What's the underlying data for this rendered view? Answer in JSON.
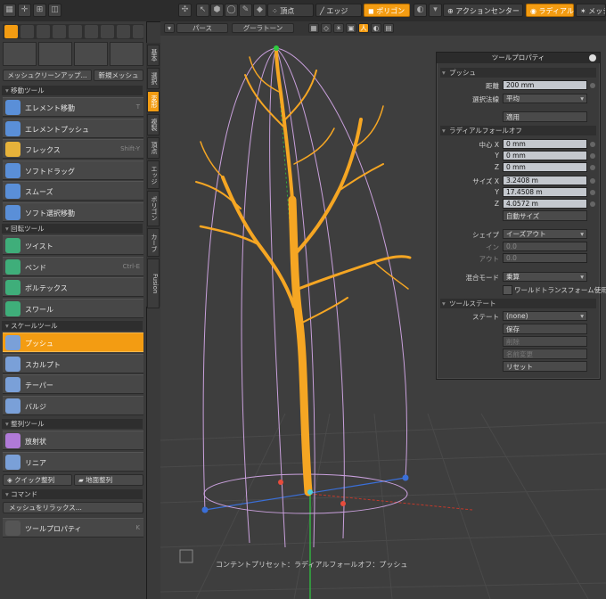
{
  "toolbar": {
    "vertex": "頂点",
    "edge": "エッジ",
    "polygon": "ポリゴン",
    "action_center": "アクションセンター",
    "radial": "ラディアル",
    "mesh": "メッシュ"
  },
  "viewport_header": {
    "perspective": "パース",
    "shading": "グーラトーン"
  },
  "left_panel": {
    "top_buttons": {
      "mesh_cleanup": "メッシュクリーンアップ...",
      "new_mesh": "新規メッシュ"
    },
    "sections": {
      "move": "移動ツール",
      "rotate": "回転ツール",
      "scale": "スケールツール",
      "align": "整列ツール",
      "command": "コマンド"
    },
    "move_tools": [
      {
        "label": "エレメント移動",
        "shortcut": "T"
      },
      {
        "label": "エレメントプッシュ",
        "shortcut": ""
      },
      {
        "label": "フレックス",
        "shortcut": "Shift-Y"
      },
      {
        "label": "ソフトドラッグ",
        "shortcut": ""
      },
      {
        "label": "スムーズ",
        "shortcut": ""
      },
      {
        "label": "ソフト選択移動",
        "shortcut": ""
      }
    ],
    "rotate_tools": [
      {
        "label": "ツイスト",
        "shortcut": ""
      },
      {
        "label": "ベンド",
        "shortcut": "Ctrl-E"
      },
      {
        "label": "ボルテックス",
        "shortcut": ""
      },
      {
        "label": "スワール",
        "shortcut": ""
      }
    ],
    "scale_tools": [
      {
        "label": "プッシュ",
        "shortcut": ""
      },
      {
        "label": "スカルプト",
        "shortcut": ""
      },
      {
        "label": "テーパー",
        "shortcut": ""
      },
      {
        "label": "バルジ",
        "shortcut": ""
      }
    ],
    "align_tools": [
      {
        "label": "放射状",
        "shortcut": ""
      },
      {
        "label": "リニア",
        "shortcut": ""
      }
    ],
    "quick_align": "クイック整列",
    "ground_align": "地面整列",
    "relax": "メッシュをリラックス...",
    "tool_properties": {
      "label": "ツールプロパティ",
      "shortcut": "K"
    }
  },
  "vertical_tabs": [
    "Fusion",
    "カーブ",
    "ポリゴン",
    "エッジ",
    "頂点",
    "複製",
    "変形",
    "選択",
    "基本"
  ],
  "tool_properties": {
    "title": "ツールプロパティ",
    "push_section": "プッシュ",
    "distance_label": "距離",
    "distance_value": "200 mm",
    "normal_label": "選択法線",
    "normal_value": "平均",
    "apply": "適用",
    "falloff_section": "ラディアルフォールオフ",
    "center_label": "中心 X",
    "y_label": "Y",
    "z_label": "Z",
    "center_x": "0 mm",
    "center_y": "0 mm",
    "center_z": "0 mm",
    "size_label": "サイズ X",
    "size_x": "3.2408 m",
    "size_y": "17.4508 m",
    "size_z": "4.0572 m",
    "auto_size": "自動サイズ",
    "shape_label": "シェイプ",
    "shape_value": "イーズアウト",
    "in_label": "イン",
    "in_value": "0.0",
    "out_label": "アウト",
    "out_value": "0.0",
    "blend_label": "混合モード",
    "blend_value": "乗算",
    "world_transform": "ワールドトランスフォーム使用",
    "state_section": "ツールステート",
    "state_label": "ステート",
    "state_value": "(none)",
    "save": "保存",
    "delete": "削除",
    "rename": "名前変更",
    "reset": "リセット"
  },
  "status_line": "コンテントプリセット：ラディアルフォールオフ：プッシュ",
  "colors": {
    "accent": "#f39c12",
    "tree": "#f5a623",
    "falloff": "#c9a0dc"
  }
}
